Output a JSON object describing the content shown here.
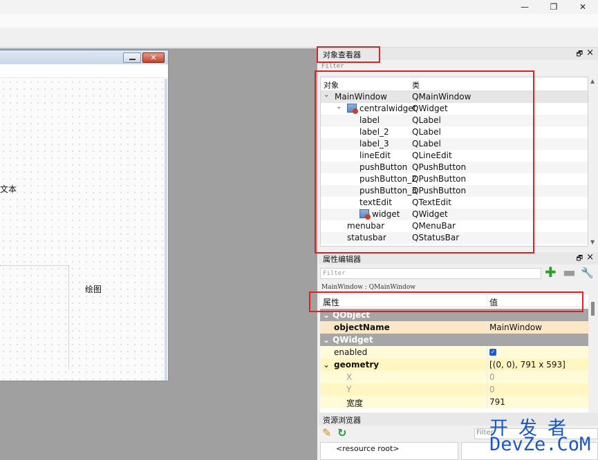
{
  "window": {
    "minimize_icon": "minimize-icon",
    "restore_icon": "restore-icon",
    "close_icon": "close-icon"
  },
  "form": {
    "label_text": "文本",
    "label_draw": "绘图"
  },
  "object_inspector": {
    "title": "对象查看器",
    "filter_placeholder": "Filter",
    "col_object": "对象",
    "col_class": "类",
    "rows": [
      {
        "object": "MainWindow",
        "class": "QMainWindow"
      },
      {
        "object": "centralwidget",
        "class": "QWidget"
      },
      {
        "object": "label",
        "class": "QLabel"
      },
      {
        "object": "label_2",
        "class": "QLabel"
      },
      {
        "object": "label_3",
        "class": "QLabel"
      },
      {
        "object": "lineEdit",
        "class": "QLineEdit"
      },
      {
        "object": "pushButton",
        "class": "QPushButton"
      },
      {
        "object": "pushButton_2",
        "class": "QPushButton"
      },
      {
        "object": "pushButton_3",
        "class": "QPushButton"
      },
      {
        "object": "textEdit",
        "class": "QTextEdit"
      },
      {
        "object": "widget",
        "class": "QWidget"
      },
      {
        "object": "menubar",
        "class": "QMenuBar"
      },
      {
        "object": "statusbar",
        "class": "QStatusBar"
      }
    ]
  },
  "property_editor": {
    "title": "属性编辑器",
    "filter_placeholder": "Filter",
    "object_line": "MainWindow : QMainWindow",
    "col_property": "属性",
    "col_value": "值",
    "groups": {
      "qobject": "QObject",
      "qwidget": "QWidget"
    },
    "props": {
      "objectName": {
        "name": "objectName",
        "value": "MainWindow"
      },
      "enabled": {
        "name": "enabled",
        "checked": true
      },
      "geometry": {
        "name": "geometry",
        "value": "[(0, 0), 791 x 593]"
      },
      "x": {
        "name": "X",
        "value": "0"
      },
      "y": {
        "name": "Y",
        "value": "0"
      },
      "width": {
        "name": "宽度",
        "value": "791"
      }
    }
  },
  "resource_browser": {
    "title": "资源浏览器",
    "filter_placeholder": "Filter",
    "root": "<resource root>"
  },
  "watermark": {
    "line1": "开发者",
    "line2": "DevZe.CoM"
  },
  "colors": {
    "highlight_red": "#e02020",
    "group_gray": "#a6a6a6",
    "prop_yellow": "#fffbd9",
    "watermark_blue": "#1a56c7"
  }
}
